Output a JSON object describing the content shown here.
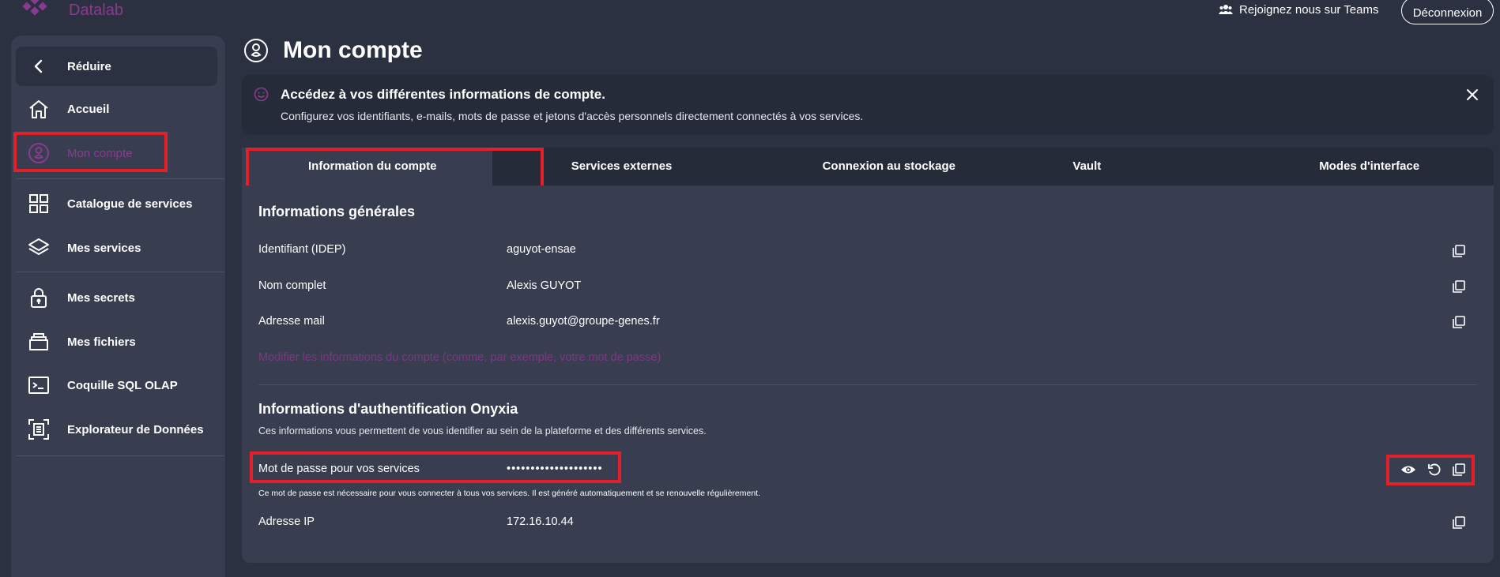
{
  "app": {
    "name": "Datalab",
    "brand_color": "#8a3b8f",
    "highlight_color": "#e3202a"
  },
  "header": {
    "teams_label": "Rejoignez nous sur Teams",
    "logout_label": "Déconnexion"
  },
  "sidebar": {
    "collapse_label": "Réduire",
    "items": [
      {
        "label": "Accueil",
        "icon": "home-icon"
      },
      {
        "label": "Mon compte",
        "icon": "account-icon",
        "active": true
      },
      {
        "label": "Catalogue de services",
        "icon": "grid-icon"
      },
      {
        "label": "Mes services",
        "icon": "layers-icon"
      },
      {
        "label": "Mes secrets",
        "icon": "lock-icon"
      },
      {
        "label": "Mes fichiers",
        "icon": "folder-icon"
      },
      {
        "label": "Coquille SQL OLAP",
        "icon": "terminal-icon"
      },
      {
        "label": "Explorateur de Données",
        "icon": "data-explorer-icon"
      }
    ]
  },
  "page": {
    "title": "Mon compte"
  },
  "banner": {
    "title": "Accédez à vos différentes informations de compte.",
    "subtitle": "Configurez vos identifiants, e-mails, mots de passe et jetons d'accès personnels directement connectés à vos services."
  },
  "tabs": [
    {
      "label": "Information du compte",
      "active": true
    },
    {
      "label": "Services externes"
    },
    {
      "label": "Connexion au stockage"
    },
    {
      "label": "Vault"
    },
    {
      "label": "Modes d'interface"
    }
  ],
  "general": {
    "title": "Informations générales",
    "rows": [
      {
        "label": "Identifiant (IDEP)",
        "value": "aguyot-ensae"
      },
      {
        "label": "Nom complet",
        "value": "Alexis GUYOT"
      },
      {
        "label": "Adresse mail",
        "value": "alexis.guyot@groupe-genes.fr"
      }
    ],
    "modify_link": "Modifier les informations du compte (comme, par exemple, votre mot de passe)"
  },
  "auth": {
    "title": "Informations d'authentification Onyxia",
    "description": "Ces informations vous permettent de vous identifier au sein de la plateforme et des différents services.",
    "password_label": "Mot de passe pour vos services",
    "password_value": "••••••••••••••••••••",
    "password_help": "Ce mot de passe est nécessaire pour vous connecter à tous vos services. Il est généré automatiquement et se renouvelle régulièrement.",
    "ip_label": "Adresse IP",
    "ip_value": "172.16.10.44"
  }
}
